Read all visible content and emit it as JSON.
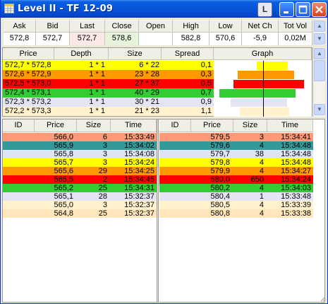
{
  "window": {
    "title": "Level II - TF 12-09",
    "L_button": "L"
  },
  "summary": {
    "headers": [
      "Ask",
      "Bid",
      "Last",
      "Close",
      "Open",
      "High",
      "Low",
      "Net Ch",
      "Tot Vol"
    ],
    "values": [
      "572,8",
      "572,7",
      "572,7",
      "578,6",
      "",
      "582,8",
      "570,6",
      "-5,9",
      "0,02M"
    ]
  },
  "depth": {
    "headers": [
      "Price",
      "Depth",
      "Size",
      "Spread",
      "Graph"
    ],
    "rows": [
      {
        "price": "572,7 * 572,8",
        "depth": "1 * 1",
        "size": "6 * 22",
        "spread": "0,1",
        "color": "#ffff00",
        "text": "#000000"
      },
      {
        "price": "572,6 * 572,9",
        "depth": "1 * 1",
        "size": "23 * 28",
        "spread": "0,3",
        "color": "#ff9900",
        "text": "#000000"
      },
      {
        "price": "572,5 * 573,0",
        "depth": "1 * 1",
        "size": "27 * 37",
        "spread": "0,5",
        "color": "#ff0000",
        "text": "#000000"
      },
      {
        "price": "572,4 * 573,1",
        "depth": "1 * 1",
        "size": "40 * 29",
        "spread": "0,7",
        "color": "#33cc33",
        "text": "#000000"
      },
      {
        "price": "572,3 * 573,2",
        "depth": "1 * 1",
        "size": "30 * 21",
        "spread": "0,9",
        "color": "#e4e4f4",
        "text": "#000000"
      },
      {
        "price": "572,2 * 573,3",
        "depth": "1 * 1",
        "size": "21 * 23",
        "spread": "1,1",
        "color": "#fff2cc",
        "text": "#000000"
      }
    ],
    "graph_bars": [
      {
        "bid": 6,
        "ask": 22,
        "color": "#ffff00"
      },
      {
        "bid": 23,
        "ask": 28,
        "color": "#ff9900"
      },
      {
        "bid": 27,
        "ask": 37,
        "color": "#ff0000"
      },
      {
        "bid": 40,
        "ask": 29,
        "color": "#33cc33"
      },
      {
        "bid": 30,
        "ask": 21,
        "color": "#e4e4f4"
      },
      {
        "bid": 21,
        "ask": 23,
        "color": "#fff2cc"
      }
    ]
  },
  "bid_list": {
    "headers": [
      "ID",
      "Price",
      "Size",
      "Time"
    ],
    "rows": [
      {
        "price": "566,0",
        "size": "6",
        "time": "15:33:49",
        "color": "#ff9977"
      },
      {
        "price": "565,9",
        "size": "3",
        "time": "15:34:02",
        "color": "#339999"
      },
      {
        "price": "565,8",
        "size": "3",
        "time": "15:34:08",
        "color": "#dde4f4"
      },
      {
        "price": "565,7",
        "size": "3",
        "time": "15:34:24",
        "color": "#ffff00"
      },
      {
        "price": "565,6",
        "size": "29",
        "time": "15:34:25",
        "color": "#ff9900"
      },
      {
        "price": "565,5",
        "size": "2",
        "time": "15:34:45",
        "color": "#ff0000"
      },
      {
        "price": "565,2",
        "size": "25",
        "time": "15:34:31",
        "color": "#33cc33"
      },
      {
        "price": "565,1",
        "size": "28",
        "time": "15:32:37",
        "color": "#e4e4f4"
      },
      {
        "price": "565,0",
        "size": "3",
        "time": "15:32:37",
        "color": "#fff2cc"
      },
      {
        "price": "564,8",
        "size": "25",
        "time": "15:32:37",
        "color": "#ffe6bb"
      }
    ]
  },
  "ask_list": {
    "headers": [
      "ID",
      "Price",
      "Size",
      "Time"
    ],
    "rows": [
      {
        "price": "579,5",
        "size": "3",
        "time": "15:34:41",
        "color": "#ff9977"
      },
      {
        "price": "579,6",
        "size": "4",
        "time": "15:34:48",
        "color": "#339999"
      },
      {
        "price": "579,7",
        "size": "38",
        "time": "15:34:48",
        "color": "#dde4f4"
      },
      {
        "price": "579,8",
        "size": "4",
        "time": "15:34:48",
        "color": "#ffff00"
      },
      {
        "price": "579,9",
        "size": "4",
        "time": "15:34:27",
        "color": "#ff9900"
      },
      {
        "price": "580,0",
        "size": "650",
        "time": "15:34:24",
        "color": "#ff0000"
      },
      {
        "price": "580,2",
        "size": "4",
        "time": "15:34:03",
        "color": "#33cc33"
      },
      {
        "price": "580,4",
        "size": "1",
        "time": "15:33:48",
        "color": "#e4e4f4"
      },
      {
        "price": "580,5",
        "size": "4",
        "time": "15:33:39",
        "color": "#fff2cc"
      },
      {
        "price": "580,8",
        "size": "4",
        "time": "15:33:38",
        "color": "#ffe6bb"
      }
    ]
  },
  "icons": {
    "app": "table-grid-icon",
    "minimize": "minimize-icon",
    "maximize": "maximize-icon",
    "close": "close-icon",
    "scroll_up": "arrow-up-icon",
    "scroll_down": "arrow-down-icon"
  }
}
